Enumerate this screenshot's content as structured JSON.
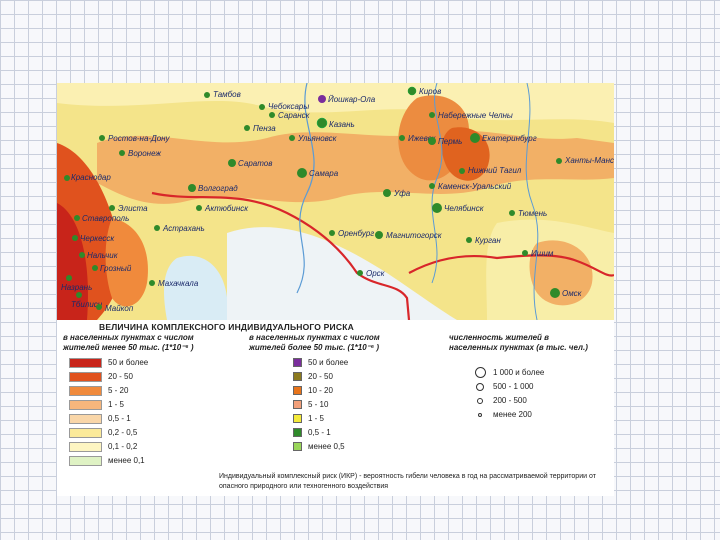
{
  "cities": [
    {
      "name": "Киров"
    },
    {
      "name": "Тамбов"
    },
    {
      "name": "Чебоксары"
    },
    {
      "name": "Йошкар-Ола"
    },
    {
      "name": "Саранск"
    },
    {
      "name": "Казань"
    },
    {
      "name": "Пенза"
    },
    {
      "name": "Ульяновск"
    },
    {
      "name": "Ижевск"
    },
    {
      "name": "Пермь"
    },
    {
      "name": "Набережные Челны"
    },
    {
      "name": "Екатеринбург"
    },
    {
      "name": "Ханты-Мансийск"
    },
    {
      "name": "Нижний Тагил"
    },
    {
      "name": "Каменск-Уральский"
    },
    {
      "name": "Саратов"
    },
    {
      "name": "Воронеж"
    },
    {
      "name": "Волгоград"
    },
    {
      "name": "Самара"
    },
    {
      "name": "Уфа"
    },
    {
      "name": "Тюмень"
    },
    {
      "name": "Челябинск"
    },
    {
      "name": "Магнитогорск"
    },
    {
      "name": "Оренбург"
    },
    {
      "name": "Курган"
    },
    {
      "name": "Ишим"
    },
    {
      "name": "Омск"
    },
    {
      "name": "Орск"
    },
    {
      "name": "Краснодар"
    },
    {
      "name": "Элиста"
    },
    {
      "name": "Астрахань"
    },
    {
      "name": "Ставрополь"
    },
    {
      "name": "Черкесск"
    },
    {
      "name": "Нальчик"
    },
    {
      "name": "Грозный"
    },
    {
      "name": "Махачкала"
    },
    {
      "name": "Назрань"
    },
    {
      "name": "Тбилиси"
    },
    {
      "name": "Майкоп"
    },
    {
      "name": "Актюбинск"
    },
    {
      "name": "Ростов-на-Дону"
    }
  ],
  "legend": {
    "title": "ВЕЛИЧИНА КОМПЛЕКСНОГО ИНДИВИДУАЛЬНОГО РИСКА",
    "col1_head_line1": "в населенных пунктах с числом",
    "col1_head_line2": "жителей менее 50 тыс. (1*10⁻⁶ )",
    "col2_head_line1": "в населенных пунктах с числом",
    "col2_head_line2": "жителей более 50 тыс. (1*10⁻⁶ )",
    "col3_head_line1": "численность жителей в",
    "col3_head_line2": "населенных пунктах (в тыс. чел.)",
    "small_settlement_risk": [
      {
        "label": "50 и более",
        "color": "#c8241a"
      },
      {
        "label": "20 - 50",
        "color": "#e0521e"
      },
      {
        "label": "5 - 20",
        "color": "#f08a3c"
      },
      {
        "label": "1 - 5",
        "color": "#f6b67c"
      },
      {
        "label": "0,5 - 1",
        "color": "#f9d6a8"
      },
      {
        "label": "0,2 - 0,5",
        "color": "#fbea9a"
      },
      {
        "label": "0,1 - 0,2",
        "color": "#fdf5c2"
      },
      {
        "label": "менее 0,1",
        "color": "#dff2c4"
      }
    ],
    "large_settlement_risk": [
      {
        "label": "50 и более",
        "color": "#7a2d9c"
      },
      {
        "label": "20 - 50",
        "color": "#8c7a1e"
      },
      {
        "label": "10 - 20",
        "color": "#e8741a"
      },
      {
        "label": "5 - 10",
        "color": "#f2a07a"
      },
      {
        "label": "1 - 5",
        "color": "#f4ea3a"
      },
      {
        "label": "0,5 - 1",
        "color": "#2f8a2a"
      },
      {
        "label": "менее 0,5",
        "color": "#9ad65a"
      }
    ],
    "population": [
      {
        "label": "1 000 и более",
        "size": 11
      },
      {
        "label": "500 - 1 000",
        "size": 8
      },
      {
        "label": "200 - 500",
        "size": 6
      },
      {
        "label": "менее 200",
        "size": 4
      }
    ],
    "note": "Индивидуальный комплексный риск (ИКР) - вероятность гибели человека в год на рассматриваемой территории от опасного природного или техногенного воздействия"
  }
}
